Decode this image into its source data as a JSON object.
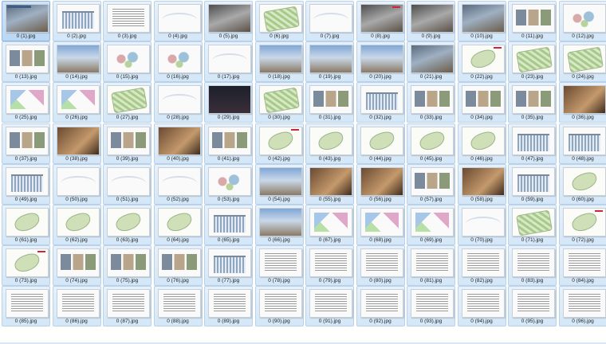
{
  "viewer": {
    "thumbnails": [
      {
        "label": "0 (1).jpg",
        "style": "t-photo t-title",
        "selected": true
      },
      {
        "label": "0 (2).jpg",
        "style": "t-white t-facade"
      },
      {
        "label": "0 (3).jpg",
        "style": "t-white t-text"
      },
      {
        "label": "0 (4).jpg",
        "style": "t-white t-curve"
      },
      {
        "label": "0 (5).jpg",
        "style": "t-grey"
      },
      {
        "label": "0 (6).jpg",
        "style": "t-plan t-green"
      },
      {
        "label": "0 (7).jpg",
        "style": "t-white t-curve"
      },
      {
        "label": "0 (8).jpg",
        "style": "t-grey t-redline"
      },
      {
        "label": "0 (9).jpg",
        "style": "t-grey"
      },
      {
        "label": "0 (10).jpg",
        "style": "t-photo"
      },
      {
        "label": "0 (11).jpg",
        "style": "t-white t-layout"
      },
      {
        "label": "0 (12).jpg",
        "style": "t-white t-diagram"
      },
      {
        "label": "0 (13).jpg",
        "style": "t-white t-layout"
      },
      {
        "label": "0 (14).jpg",
        "style": "t-photo2"
      },
      {
        "label": "0 (15).jpg",
        "style": "t-white t-diagram"
      },
      {
        "label": "0 (16).jpg",
        "style": "t-white t-diagram"
      },
      {
        "label": "0 (17).jpg",
        "style": "t-white t-curve"
      },
      {
        "label": "0 (18).jpg",
        "style": "t-photo2"
      },
      {
        "label": "0 (19).jpg",
        "style": "t-photo2"
      },
      {
        "label": "0 (20).jpg",
        "style": "t-photo2"
      },
      {
        "label": "0 (21).jpg",
        "style": "t-photo"
      },
      {
        "label": "0 (22).jpg",
        "style": "t-plan t-redline"
      },
      {
        "label": "0 (23).jpg",
        "style": "t-plan t-green"
      },
      {
        "label": "0 (24).jpg",
        "style": "t-plan t-green"
      },
      {
        "label": "0 (25).jpg",
        "style": "t-white t-cubes"
      },
      {
        "label": "0 (26).jpg",
        "style": "t-white t-cubes"
      },
      {
        "label": "0 (27).jpg",
        "style": "t-plan t-green"
      },
      {
        "label": "0 (28).jpg",
        "style": "t-white t-curve"
      },
      {
        "label": "0 (29).jpg",
        "style": "t-dark"
      },
      {
        "label": "0 (30).jpg",
        "style": "t-plan t-green"
      },
      {
        "label": "0 (31).jpg",
        "style": "t-white t-layout"
      },
      {
        "label": "0 (32).jpg",
        "style": "t-white t-facade"
      },
      {
        "label": "0 (33).jpg",
        "style": "t-white t-layout"
      },
      {
        "label": "0 (34).jpg",
        "style": "t-white t-layout"
      },
      {
        "label": "0 (35).jpg",
        "style": "t-white t-layout"
      },
      {
        "label": "0 (36).jpg",
        "style": "t-warm"
      },
      {
        "label": "0 (37).jpg",
        "style": "t-white t-layout"
      },
      {
        "label": "0 (38).jpg",
        "style": "t-warm"
      },
      {
        "label": "0 (39).jpg",
        "style": "t-white t-layout"
      },
      {
        "label": "0 (40).jpg",
        "style": "t-warm"
      },
      {
        "label": "0 (41).jpg",
        "style": "t-white t-layout"
      },
      {
        "label": "0 (42).jpg",
        "style": "t-plan t-redline"
      },
      {
        "label": "0 (43).jpg",
        "style": "t-plan"
      },
      {
        "label": "0 (44).jpg",
        "style": "t-plan"
      },
      {
        "label": "0 (45).jpg",
        "style": "t-plan"
      },
      {
        "label": "0 (46).jpg",
        "style": "t-plan"
      },
      {
        "label": "0 (47).jpg",
        "style": "t-white t-facade"
      },
      {
        "label": "0 (48).jpg",
        "style": "t-white t-facade"
      },
      {
        "label": "0 (49).jpg",
        "style": "t-white t-facade"
      },
      {
        "label": "0 (50).jpg",
        "style": "t-white t-curve"
      },
      {
        "label": "0 (51).jpg",
        "style": "t-white t-curve"
      },
      {
        "label": "0 (52).jpg",
        "style": "t-white t-curve"
      },
      {
        "label": "0 (53).jpg",
        "style": "t-white t-diagram"
      },
      {
        "label": "0 (54).jpg",
        "style": "t-photo2"
      },
      {
        "label": "0 (55).jpg",
        "style": "t-warm"
      },
      {
        "label": "0 (56).jpg",
        "style": "t-warm"
      },
      {
        "label": "0 (57).jpg",
        "style": "t-white t-layout"
      },
      {
        "label": "0 (58).jpg",
        "style": "t-warm"
      },
      {
        "label": "0 (59).jpg",
        "style": "t-white t-facade"
      },
      {
        "label": "0 (60).jpg",
        "style": "t-plan"
      },
      {
        "label": "0 (61).jpg",
        "style": "t-plan"
      },
      {
        "label": "0 (62).jpg",
        "style": "t-plan"
      },
      {
        "label": "0 (63).jpg",
        "style": "t-plan"
      },
      {
        "label": "0 (64).jpg",
        "style": "t-plan"
      },
      {
        "label": "0 (65).jpg",
        "style": "t-white t-facade"
      },
      {
        "label": "0 (66).jpg",
        "style": "t-photo2"
      },
      {
        "label": "0 (67).jpg",
        "style": "t-white t-cubes"
      },
      {
        "label": "0 (68).jpg",
        "style": "t-white t-cubes"
      },
      {
        "label": "0 (69).jpg",
        "style": "t-white t-cubes"
      },
      {
        "label": "0 (70).jpg",
        "style": "t-white t-curve"
      },
      {
        "label": "0 (71).jpg",
        "style": "t-plan t-green"
      },
      {
        "label": "0 (72).jpg",
        "style": "t-plan t-redline"
      },
      {
        "label": "0 (73).jpg",
        "style": "t-plan t-redline"
      },
      {
        "label": "0 (74).jpg",
        "style": "t-white t-layout"
      },
      {
        "label": "0 (75).jpg",
        "style": "t-white t-layout"
      },
      {
        "label": "0 (76).jpg",
        "style": "t-white t-layout"
      },
      {
        "label": "0 (77).jpg",
        "style": "t-white t-facade"
      },
      {
        "label": "0 (78).jpg",
        "style": "t-white t-text"
      },
      {
        "label": "0 (79).jpg",
        "style": "t-white t-text"
      },
      {
        "label": "0 (80).jpg",
        "style": "t-white t-text"
      },
      {
        "label": "0 (81).jpg",
        "style": "t-white t-text"
      },
      {
        "label": "0 (82).jpg",
        "style": "t-white t-text"
      },
      {
        "label": "0 (83).jpg",
        "style": "t-white t-text"
      },
      {
        "label": "0 (84).jpg",
        "style": "t-white t-text"
      },
      {
        "label": "0 (85).jpg",
        "style": "t-white t-text"
      },
      {
        "label": "0 (86).jpg",
        "style": "t-white t-text"
      },
      {
        "label": "0 (87).jpg",
        "style": "t-white t-text"
      },
      {
        "label": "0 (88).jpg",
        "style": "t-white t-text"
      },
      {
        "label": "0 (89).jpg",
        "style": "t-white t-text"
      },
      {
        "label": "0 (90).jpg",
        "style": "t-white t-text"
      },
      {
        "label": "0 (91).jpg",
        "style": "t-white t-text"
      },
      {
        "label": "0 (92).jpg",
        "style": "t-white t-text"
      },
      {
        "label": "0 (93).jpg",
        "style": "t-white t-text"
      },
      {
        "label": "0 (94).jpg",
        "style": "t-white t-text"
      },
      {
        "label": "0 (95).jpg",
        "style": "t-white t-text"
      },
      {
        "label": "0 (96).jpg",
        "style": "t-white t-text"
      }
    ]
  }
}
